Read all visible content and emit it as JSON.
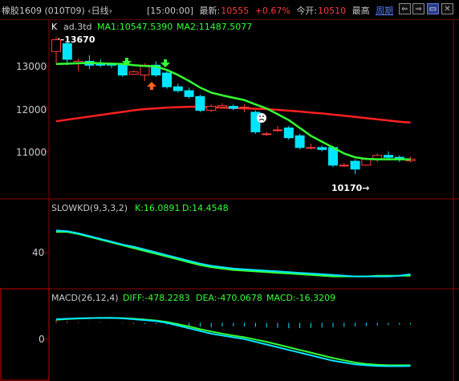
{
  "header": {
    "title": "橡胶1609 (010T09) ‹日线›",
    "time": "[15:00:00]",
    "latest_label": "最新:",
    "latest_value": "10555",
    "change_pct": "+0.67%",
    "open_label": "今开:",
    "open_value": "10510",
    "high_label": "最高",
    "period_link": "周期"
  },
  "window_buttons": [
    "⇐",
    "⇒",
    "▭",
    "✕"
  ],
  "main_panel": {
    "legend_k": "K",
    "legend_period": "ad.3td",
    "ma1_label": "MA1:10547.5390",
    "ma2_label": "MA2:11487.5077",
    "high_annotation": "←13670",
    "low_annotation": "10170→",
    "y_ticks": [
      "13000",
      "12000",
      "11000"
    ]
  },
  "kd_panel": {
    "title": "SLOWKD(9,3,3,2)",
    "k_label": "K:16.0891",
    "d_label": "D:14.4548",
    "y_ticks": [
      "40"
    ]
  },
  "macd_panel": {
    "title": "MACD(26,12,4)",
    "diff_label": "DIFF:-478.2283",
    "dea_label": "DEA:-470.0678",
    "macd_label": "MACD:-16.3209",
    "y_ticks": [
      "0"
    ]
  },
  "colors": {
    "up": "#ff3b3b",
    "down": "#00e5ff",
    "ma1": "#33ff33",
    "ma2": "#ff2020",
    "k_line": "#ffffff",
    "d_line": "#33ff33",
    "macd_bar": "#00e5ff",
    "grid": "#8b0000",
    "magenta": "#ff40ff"
  },
  "chart_data": [
    {
      "type": "candlestick",
      "title": "",
      "ylim": [
        9600,
        14000
      ],
      "candles": [
        {
          "o": 13300,
          "c": 13600,
          "h": 13670,
          "l": 13000
        },
        {
          "o": 13500,
          "c": 13100,
          "h": 13550,
          "l": 12950
        },
        {
          "o": 13000,
          "c": 13050,
          "h": 13120,
          "l": 12800
        },
        {
          "o": 13050,
          "c": 12950,
          "h": 13200,
          "l": 12850
        },
        {
          "o": 13000,
          "c": 12950,
          "h": 13100,
          "l": 12900
        },
        {
          "o": 12980,
          "c": 12950,
          "h": 13020,
          "l": 12880
        },
        {
          "o": 12950,
          "c": 12700,
          "h": 13000,
          "l": 12650
        },
        {
          "o": 12720,
          "c": 12780,
          "h": 12820,
          "l": 12700
        },
        {
          "o": 12700,
          "c": 12950,
          "h": 13000,
          "l": 12550
        },
        {
          "o": 12950,
          "c": 12700,
          "h": 13050,
          "l": 12650
        },
        {
          "o": 12750,
          "c": 12400,
          "h": 12800,
          "l": 12350
        },
        {
          "o": 12400,
          "c": 12300,
          "h": 12480,
          "l": 12250
        },
        {
          "o": 12300,
          "c": 12150,
          "h": 12380,
          "l": 12100
        },
        {
          "o": 12150,
          "c": 11800,
          "h": 12200,
          "l": 11750
        },
        {
          "o": 11800,
          "c": 11900,
          "h": 11950,
          "l": 11750
        },
        {
          "o": 11880,
          "c": 11920,
          "h": 11980,
          "l": 11850
        },
        {
          "o": 11900,
          "c": 11850,
          "h": 11950,
          "l": 11800
        },
        {
          "o": 11880,
          "c": 11880,
          "h": 11950,
          "l": 11750
        },
        {
          "o": 11750,
          "c": 11250,
          "h": 11800,
          "l": 11200
        },
        {
          "o": 11200,
          "c": 11200,
          "h": 11250,
          "l": 11150
        },
        {
          "o": 11300,
          "c": 11300,
          "h": 11400,
          "l": 11250
        },
        {
          "o": 11350,
          "c": 11100,
          "h": 11400,
          "l": 11050
        },
        {
          "o": 11150,
          "c": 10850,
          "h": 11200,
          "l": 10800
        },
        {
          "o": 10850,
          "c": 10850,
          "h": 10950,
          "l": 10800
        },
        {
          "o": 10850,
          "c": 10800,
          "h": 10900,
          "l": 10750
        },
        {
          "o": 10850,
          "c": 10400,
          "h": 10900,
          "l": 10350
        },
        {
          "o": 10400,
          "c": 10400,
          "h": 10450,
          "l": 10350
        },
        {
          "o": 10500,
          "c": 10300,
          "h": 10550,
          "l": 10170
        },
        {
          "o": 10400,
          "c": 10550,
          "h": 10600,
          "l": 10380
        },
        {
          "o": 10550,
          "c": 10650,
          "h": 10700,
          "l": 10480
        },
        {
          "o": 10650,
          "c": 10600,
          "h": 10750,
          "l": 10550
        },
        {
          "o": 10600,
          "c": 10550,
          "h": 10650,
          "l": 10480
        },
        {
          "o": 10510,
          "c": 10555,
          "h": 10620,
          "l": 10470
        }
      ],
      "ma1": [
        12980,
        12990,
        13000,
        13010,
        13000,
        12990,
        12980,
        12950,
        12930,
        12920,
        12830,
        12700,
        12550,
        12380,
        12250,
        12180,
        12120,
        12060,
        11950,
        11850,
        11700,
        11550,
        11350,
        11150,
        11000,
        10850,
        10700,
        10600,
        10560,
        10550,
        10550,
        10550,
        10547
      ],
      "ma2": [
        11520,
        11560,
        11600,
        11640,
        11680,
        11720,
        11760,
        11800,
        11830,
        11850,
        11870,
        11880,
        11890,
        11890,
        11880,
        11870,
        11860,
        11850,
        11840,
        11830,
        11810,
        11790,
        11770,
        11740,
        11720,
        11690,
        11660,
        11630,
        11600,
        11570,
        11540,
        11510,
        11487
      ]
    },
    {
      "type": "line",
      "title": "SLOWKD(9,3,3,2)",
      "ylim": [
        0,
        100
      ],
      "series": [
        {
          "name": "K",
          "values": [
            78,
            77,
            74,
            70,
            66,
            62,
            58,
            55,
            51,
            47,
            43,
            39,
            35,
            31,
            28,
            26,
            24,
            23,
            22,
            21,
            20,
            19,
            18,
            17,
            16,
            15,
            14,
            13,
            13,
            13,
            13,
            14,
            16
          ]
        },
        {
          "name": "D",
          "values": [
            76,
            76,
            73,
            69,
            65,
            61,
            57,
            53,
            49,
            45,
            41,
            37,
            33,
            29,
            26,
            24,
            22,
            21,
            20,
            19,
            18,
            17,
            16,
            15,
            14,
            13,
            13,
            13,
            13,
            14,
            14,
            14,
            14
          ]
        }
      ]
    },
    {
      "type": "line",
      "title": "MACD(26,12,4)",
      "ylim": [
        -600,
        200
      ],
      "series": [
        {
          "name": "DIFF",
          "values": [
            40,
            45,
            50,
            52,
            55,
            54,
            50,
            40,
            30,
            20,
            0,
            -30,
            -60,
            -90,
            -120,
            -140,
            -160,
            -180,
            -210,
            -240,
            -270,
            -300,
            -330,
            -360,
            -390,
            -420,
            -440,
            -460,
            -470,
            -478,
            -480,
            -480,
            -478
          ]
        },
        {
          "name": "DEA",
          "values": [
            35,
            42,
            48,
            52,
            54,
            55,
            52,
            45,
            36,
            26,
            10,
            -15,
            -40,
            -70,
            -95,
            -120,
            -140,
            -160,
            -185,
            -210,
            -240,
            -270,
            -300,
            -330,
            -360,
            -390,
            -415,
            -440,
            -455,
            -465,
            -470,
            -470,
            -470
          ]
        },
        {
          "name": "MACD",
          "values": [
            30,
            18,
            10,
            5,
            8,
            2,
            -5,
            -10,
            -12,
            -14,
            -18,
            -22,
            -30,
            -45,
            -50,
            -40,
            -38,
            -40,
            -45,
            -50,
            -55,
            -60,
            -58,
            -55,
            -52,
            -50,
            -45,
            -40,
            -35,
            -30,
            -25,
            -20,
            -16
          ]
        }
      ]
    }
  ]
}
